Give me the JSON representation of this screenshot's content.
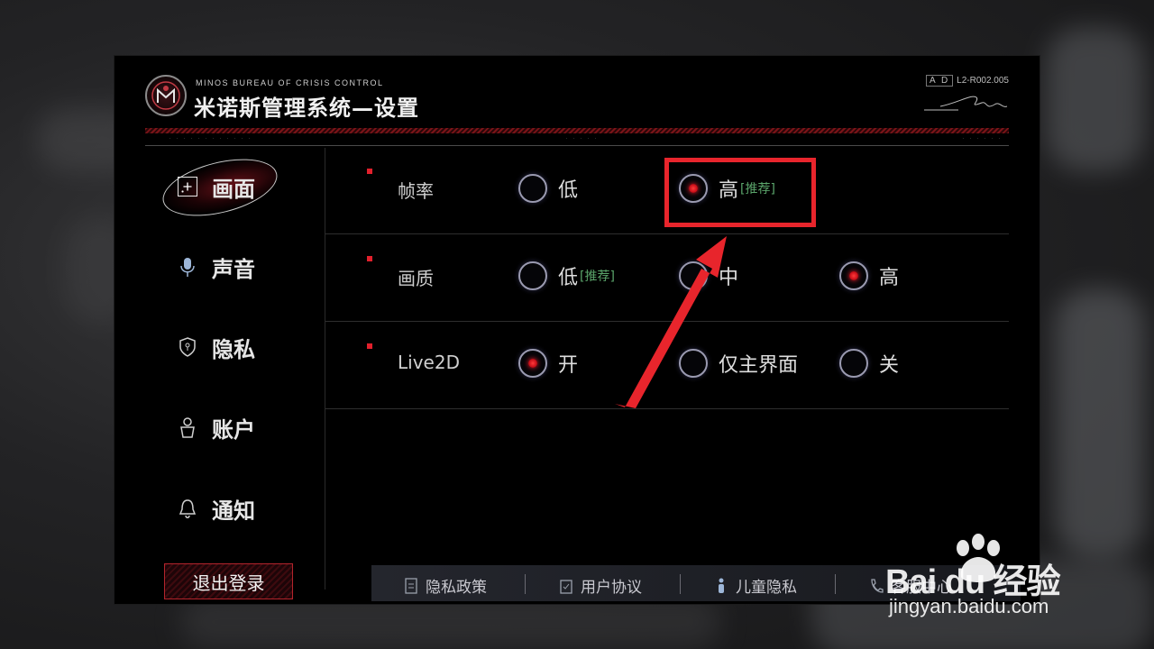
{
  "header": {
    "subtitle": "MINOS BUREAU OF  CRISIS CONTROL",
    "title": "米诺斯管理系统—设置",
    "code_box": "A D",
    "code": "L2-R002.005"
  },
  "sidebar": {
    "items": [
      {
        "label": "画面",
        "icon": "frame-icon",
        "active": true
      },
      {
        "label": "声音",
        "icon": "microphone-icon",
        "active": false
      },
      {
        "label": "隐私",
        "icon": "shield-icon",
        "active": false
      },
      {
        "label": "账户",
        "icon": "user-icon",
        "active": false
      },
      {
        "label": "通知",
        "icon": "bell-icon",
        "active": false
      }
    ],
    "logout_label": "退出登录"
  },
  "settings": [
    {
      "label": "帧率",
      "options": [
        {
          "text": "低",
          "tag": "",
          "selected": false
        },
        {
          "text": "高",
          "tag": "[推荐]",
          "selected": true
        }
      ]
    },
    {
      "label": "画质",
      "options": [
        {
          "text": "低",
          "tag": "[推荐]",
          "selected": false
        },
        {
          "text": "中",
          "tag": "",
          "selected": false
        },
        {
          "text": "高",
          "tag": "",
          "selected": true
        }
      ]
    },
    {
      "label": "Live2D",
      "options": [
        {
          "text": "开",
          "tag": "",
          "selected": true
        },
        {
          "text": "仅主界面",
          "tag": "",
          "selected": false
        },
        {
          "text": "关",
          "tag": "",
          "selected": false
        }
      ]
    }
  ],
  "footer": {
    "links": [
      {
        "label": "隐私政策",
        "icon": "document-icon"
      },
      {
        "label": "用户协议",
        "icon": "clipboard-icon"
      },
      {
        "label": "儿童隐私",
        "icon": "child-icon"
      },
      {
        "label": "客服中心",
        "icon": "phone-icon"
      }
    ]
  },
  "watermark": {
    "brand": "Bai du 经验",
    "url": "jingyan.baidu.com"
  },
  "colors": {
    "accent_red": "#e2202c",
    "recommend_green": "#5aa46a",
    "annotation_red": "#e8252c"
  }
}
